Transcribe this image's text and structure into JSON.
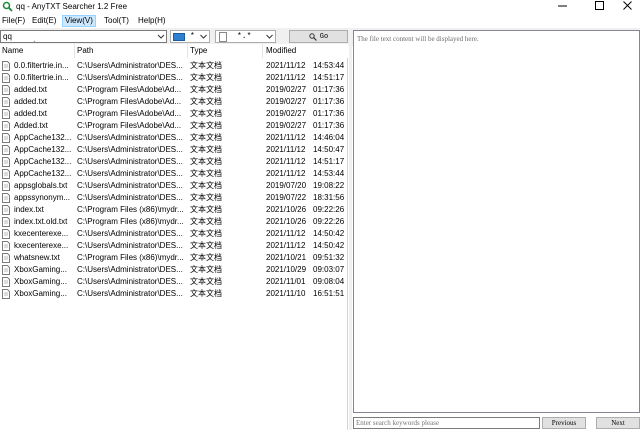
{
  "window": {
    "title": "qq - AnyTXT Searcher 1.2 Free",
    "app_icon": "search-icon",
    "controls": [
      "minimize-icon",
      "maximize-icon",
      "close-icon"
    ]
  },
  "menu": {
    "items": [
      {
        "label": "File(F)"
      },
      {
        "label": "Edit(E)"
      },
      {
        "label": "View(V)",
        "active": true
      },
      {
        "label": "Tool(T)"
      },
      {
        "label": "Help(H)"
      }
    ]
  },
  "toolbar": {
    "search_value": "qq",
    "drive_value": "*",
    "ext_value": "*.*",
    "go_label": "Go"
  },
  "list": {
    "columns": {
      "name": "Name",
      "path": "Path",
      "type": "Type",
      "modified": "Modified"
    },
    "rows": [
      {
        "name": "0.0.filtertrie.in...",
        "path": "C:\\Users\\Administrator\\DES...",
        "type": "文本文档",
        "date": "2021/11/12",
        "time": "14:53:44"
      },
      {
        "name": "0.0.filtertrie.in...",
        "path": "C:\\Users\\Administrator\\DES...",
        "type": "文本文档",
        "date": "2021/11/12",
        "time": "14:51:17"
      },
      {
        "name": "added.txt",
        "path": "C:\\Program Files\\Adobe\\Ad...",
        "type": "文本文档",
        "date": "2019/02/27",
        "time": "01:17:36"
      },
      {
        "name": "added.txt",
        "path": "C:\\Program Files\\Adobe\\Ad...",
        "type": "文本文档",
        "date": "2019/02/27",
        "time": "01:17:36"
      },
      {
        "name": "added.txt",
        "path": "C:\\Program Files\\Adobe\\Ad...",
        "type": "文本文档",
        "date": "2019/02/27",
        "time": "01:17:36"
      },
      {
        "name": "Added.txt",
        "path": "C:\\Program Files\\Adobe\\Ad...",
        "type": "文本文档",
        "date": "2019/02/27",
        "time": "01:17:36"
      },
      {
        "name": "AppCache132...",
        "path": "C:\\Users\\Administrator\\DES...",
        "type": "文本文档",
        "date": "2021/11/12",
        "time": "14:46:04"
      },
      {
        "name": "AppCache132...",
        "path": "C:\\Users\\Administrator\\DES...",
        "type": "文本文档",
        "date": "2021/11/12",
        "time": "14:50:47"
      },
      {
        "name": "AppCache132...",
        "path": "C:\\Users\\Administrator\\DES...",
        "type": "文本文档",
        "date": "2021/11/12",
        "time": "14:51:17"
      },
      {
        "name": "AppCache132...",
        "path": "C:\\Users\\Administrator\\DES...",
        "type": "文本文档",
        "date": "2021/11/12",
        "time": "14:53:44"
      },
      {
        "name": "appsglobals.txt",
        "path": "C:\\Users\\Administrator\\DES...",
        "type": "文本文档",
        "date": "2019/07/20",
        "time": "19:08:22"
      },
      {
        "name": "appssynonym...",
        "path": "C:\\Users\\Administrator\\DES...",
        "type": "文本文档",
        "date": "2019/07/22",
        "time": "18:31:56"
      },
      {
        "name": "index.txt",
        "path": "C:\\Program Files (x86)\\mydr...",
        "type": "文本文档",
        "date": "2021/10/26",
        "time": "09:22:26"
      },
      {
        "name": "index.txt.old.txt",
        "path": "C:\\Program Files (x86)\\mydr...",
        "type": "文本文档",
        "date": "2021/10/26",
        "time": "09:22:26"
      },
      {
        "name": "kxecenterexe...",
        "path": "C:\\Users\\Administrator\\DES...",
        "type": "文本文档",
        "date": "2021/11/12",
        "time": "14:50:42"
      },
      {
        "name": "kxecenterexe...",
        "path": "C:\\Users\\Administrator\\DES...",
        "type": "文本文档",
        "date": "2021/11/12",
        "time": "14:50:42"
      },
      {
        "name": "whatsnew.txt",
        "path": "C:\\Program Files (x86)\\mydr...",
        "type": "文本文档",
        "date": "2021/10/21",
        "time": "09:51:32"
      },
      {
        "name": "XboxGaming...",
        "path": "C:\\Users\\Administrator\\DES...",
        "type": "文本文档",
        "date": "2021/10/29",
        "time": "09:03:07"
      },
      {
        "name": "XboxGaming...",
        "path": "C:\\Users\\Administrator\\DES...",
        "type": "文本文档",
        "date": "2021/11/01",
        "time": "09:08:04"
      },
      {
        "name": "XboxGaming...",
        "path": "C:\\Users\\Administrator\\DES...",
        "type": "文本文档",
        "date": "2021/11/10",
        "time": "16:51:51"
      }
    ]
  },
  "preview": {
    "placeholder": "The file text content will be displayed here."
  },
  "bottom": {
    "keyword_placeholder": "Enter search keywords please",
    "previous_label": "Previous",
    "next_label": "Next"
  }
}
